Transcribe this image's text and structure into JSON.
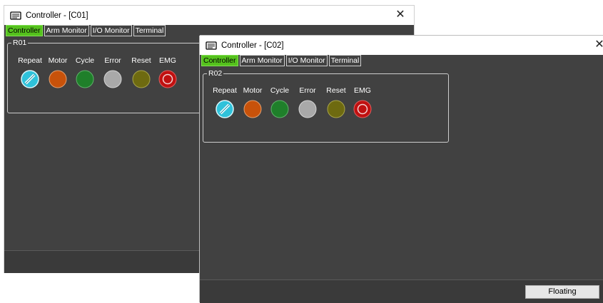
{
  "windows": [
    {
      "title": "Controller - [C01]",
      "tabs": [
        "Controller",
        "Arm Monitor",
        "I/O Monitor",
        "Terminal"
      ],
      "group_label": "R01",
      "indicators": [
        {
          "label": "Repeat",
          "icon": "repeat-icon",
          "color": "#35c8e0"
        },
        {
          "label": "Motor",
          "icon": "motor-lamp",
          "color": "#c8520a"
        },
        {
          "label": "Cycle",
          "icon": "cycle-lamp",
          "color": "#1f7f2a"
        },
        {
          "label": "Error",
          "icon": "error-lamp",
          "color": "#a9a9a9"
        },
        {
          "label": "Reset",
          "icon": "reset-lamp",
          "color": "#6e6a10"
        },
        {
          "label": "EMG",
          "icon": "emg-icon",
          "color": "#c01010"
        }
      ]
    },
    {
      "title": "Controller - [C02]",
      "tabs": [
        "Controller",
        "Arm Monitor",
        "I/O Monitor",
        "Terminal"
      ],
      "group_label": "R02",
      "indicators": [
        {
          "label": "Repeat",
          "icon": "repeat-icon",
          "color": "#35c8e0"
        },
        {
          "label": "Motor",
          "icon": "motor-lamp",
          "color": "#c8520a"
        },
        {
          "label": "Cycle",
          "icon": "cycle-lamp",
          "color": "#1f7f2a"
        },
        {
          "label": "Error",
          "icon": "error-lamp",
          "color": "#a9a9a9"
        },
        {
          "label": "Reset",
          "icon": "reset-lamp",
          "color": "#6e6a10"
        },
        {
          "label": "EMG",
          "icon": "emg-icon",
          "color": "#c01010"
        }
      ],
      "floating_button": "Floating"
    }
  ],
  "colors": {
    "window_bg": "#414141",
    "active_tab": "#55c21d"
  }
}
